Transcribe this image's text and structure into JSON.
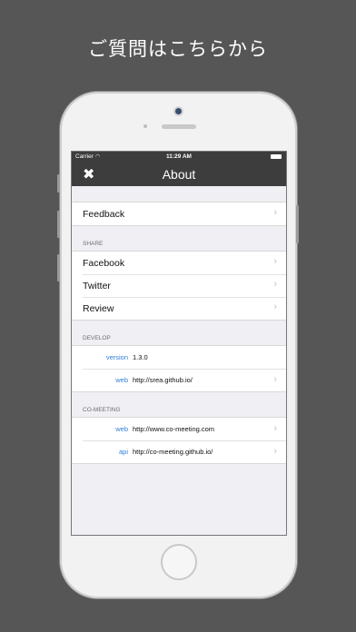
{
  "promo": {
    "title": "ご質問はこちらから"
  },
  "status_bar": {
    "carrier": "Carrier",
    "wifi_icon": "wifi-icon",
    "time": "11:29 AM",
    "battery_icon": "battery-icon"
  },
  "nav": {
    "close_icon": "close-icon",
    "close_glyph": "✖",
    "title": "About"
  },
  "feedback": {
    "label": "Feedback"
  },
  "share": {
    "header": "SHARE",
    "items": [
      {
        "label": "Facebook"
      },
      {
        "label": "Twitter"
      },
      {
        "label": "Review"
      }
    ]
  },
  "develop": {
    "header": "DEVELOP",
    "rows": [
      {
        "key": "version",
        "value": "1.3.0"
      },
      {
        "key": "web",
        "value": "http://srea.github.io/"
      }
    ]
  },
  "comeeting": {
    "header": "CO-MEETING",
    "rows": [
      {
        "key": "web",
        "value": "http://www.co-meeting.com"
      },
      {
        "key": "api",
        "value": "http://co-meeting.github.io/"
      }
    ]
  },
  "chevron": "›",
  "colors": {
    "background": "#565656",
    "navbar": "#3d3d3d",
    "link_key": "#2f7fd8"
  }
}
